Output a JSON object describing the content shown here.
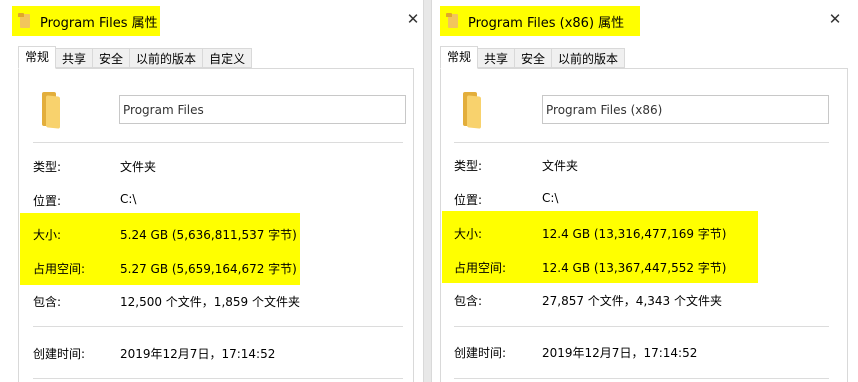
{
  "windows": [
    {
      "title": "Program Files 属性",
      "tabs": [
        "常规",
        "共享",
        "安全",
        "以前的版本",
        "自定义"
      ],
      "active_tab": "常规",
      "folder_name": "Program Files",
      "labels": {
        "type": "类型:",
        "location": "位置:",
        "size": "大小:",
        "size_on_disk": "占用空间:",
        "contains": "包含:",
        "created": "创建时间:"
      },
      "values": {
        "type": "文件夹",
        "location": "C:\\",
        "size": "5.24 GB (5,636,811,537 字节)",
        "size_on_disk": "5.27 GB (5,659,164,672 字节)",
        "contains": "12,500 个文件，1,859 个文件夹",
        "created": "2019年12月7日，17:14:52"
      }
    },
    {
      "title": "Program Files (x86) 属性",
      "tabs": [
        "常规",
        "共享",
        "安全",
        "以前的版本"
      ],
      "active_tab": "常规",
      "folder_name": "Program Files (x86)",
      "labels": {
        "type": "类型:",
        "location": "位置:",
        "size": "大小:",
        "size_on_disk": "占用空间:",
        "contains": "包含:",
        "created": "创建时间:"
      },
      "values": {
        "type": "文件夹",
        "location": "C:\\",
        "size": "12.4 GB (13,316,477,169 字节)",
        "size_on_disk": "12.4 GB (13,367,447,552 字节)",
        "contains": "27,857 个文件，4,343 个文件夹",
        "created": "2019年12月7日，17:14:52"
      }
    }
  ],
  "colors": {
    "highlight": "#ffff00",
    "folder": "#f8d26d"
  },
  "icons": {
    "title": "folder-icon",
    "close": "close-icon",
    "main": "folder-icon"
  }
}
